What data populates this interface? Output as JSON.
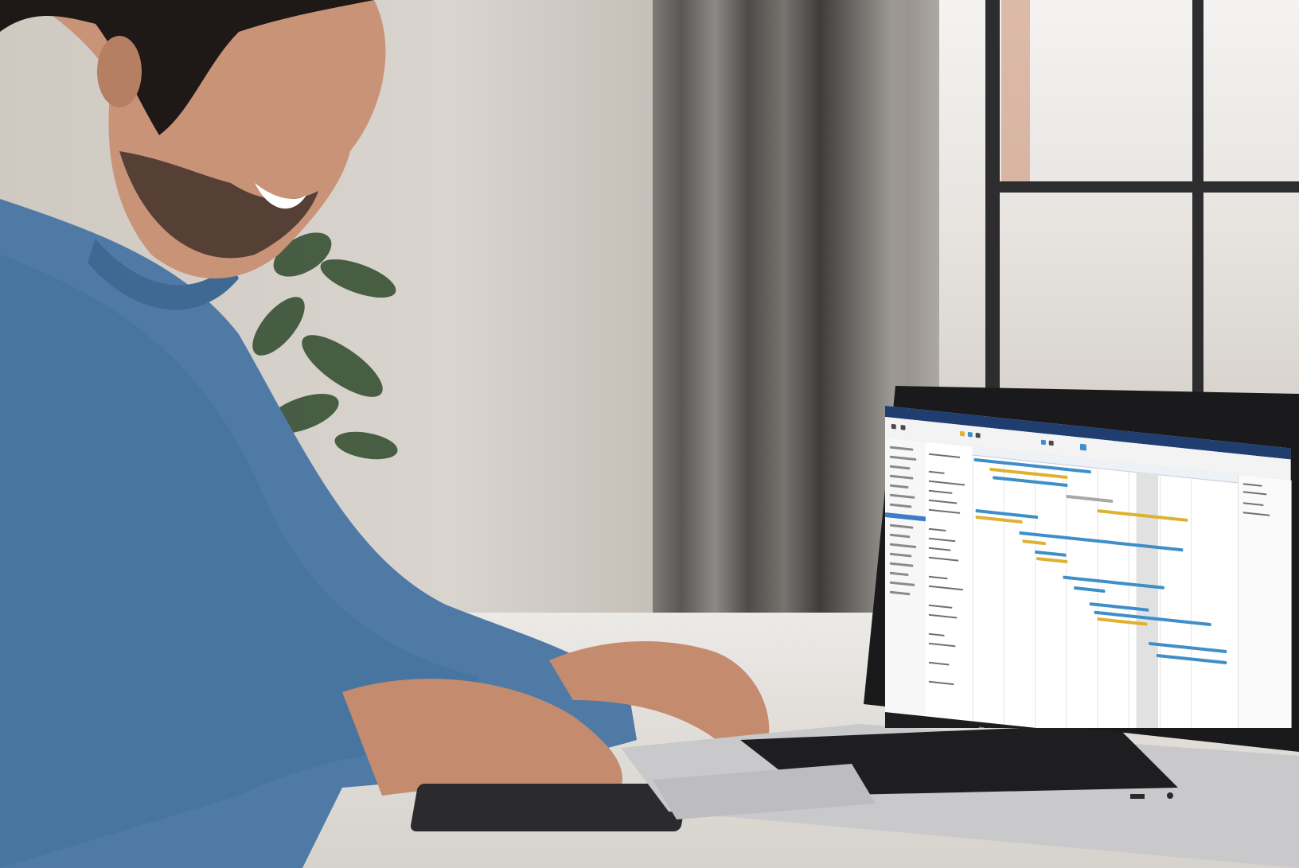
{
  "scene": {
    "description_tags": [
      "person",
      "laptop",
      "gantt-chart",
      "window",
      "curtain",
      "plant",
      "desk"
    ]
  },
  "laptop": {
    "app": {
      "window_title": "",
      "status_text": ""
    }
  },
  "colors": {
    "sweater": "#4f7aa6",
    "gantt_blue": "#3e8ec9",
    "gantt_gold": "#e0b12e",
    "titlebar": "#1f3d6e",
    "taskbar": "#1d1d1f"
  }
}
